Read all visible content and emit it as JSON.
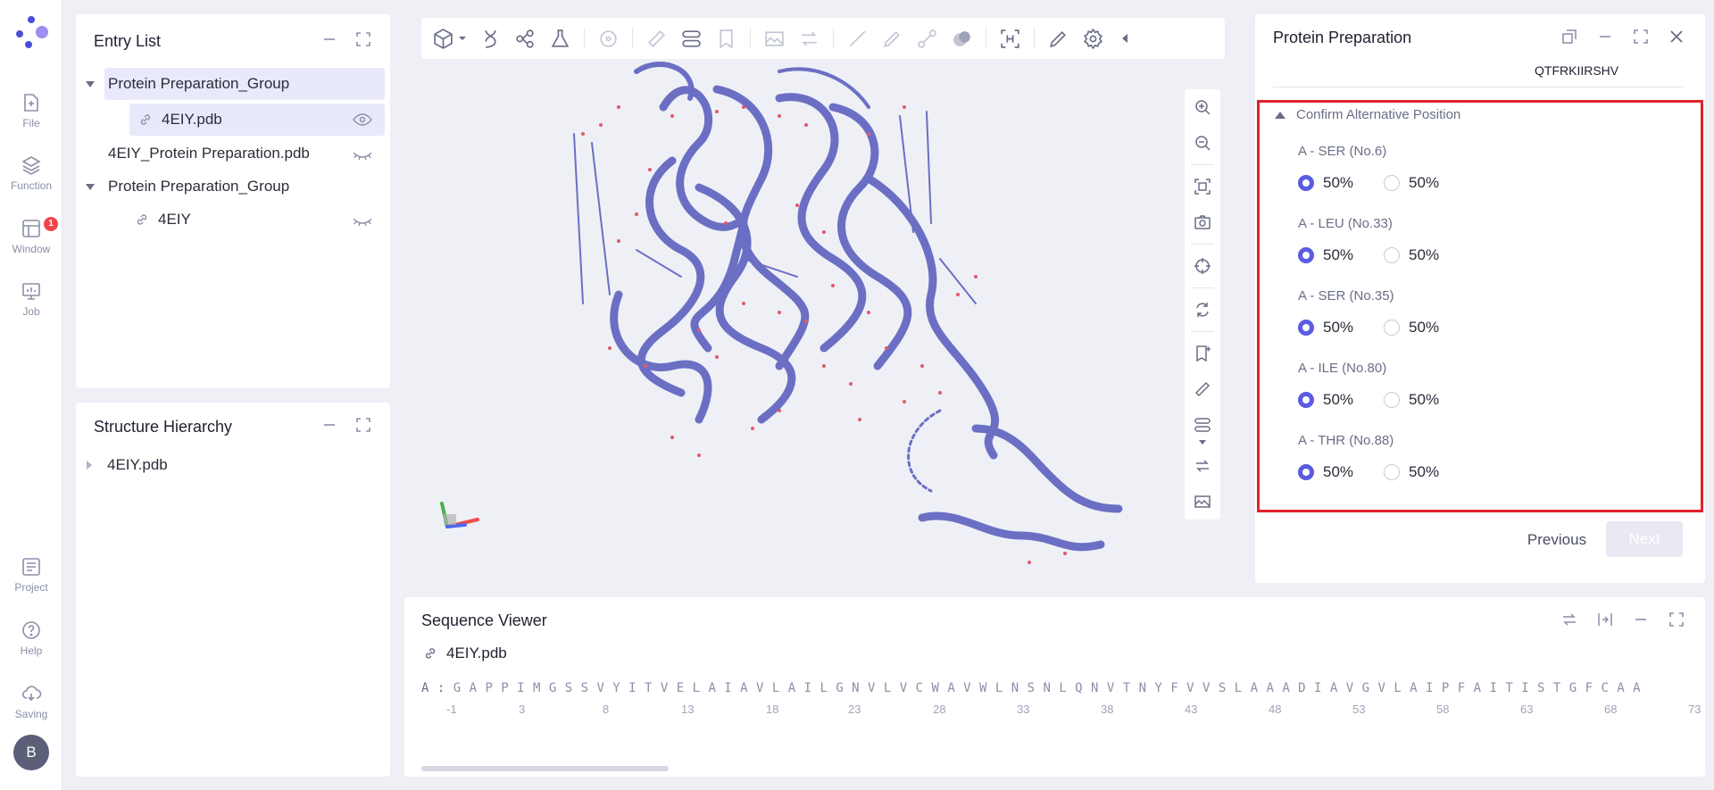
{
  "rail": {
    "file": "File",
    "function": "Function",
    "window": "Window",
    "window_badge": "1",
    "job": "Job",
    "project": "Project",
    "help": "Help",
    "saving": "Saving",
    "avatar": "B"
  },
  "entry_list": {
    "title": "Entry List",
    "items": [
      {
        "label": "Protein Preparation_Group"
      },
      {
        "label": "4EIY.pdb"
      },
      {
        "label": "4EIY_Protein Preparation.pdb"
      },
      {
        "label": "Protein Preparation_Group"
      },
      {
        "label": "4EIY"
      }
    ]
  },
  "structure_hierarchy": {
    "title": "Structure Hierarchy",
    "items": [
      {
        "label": "4EIY.pdb"
      }
    ]
  },
  "protein_preparation": {
    "title": "Protein Preparation",
    "sequence_snippet": "QTFRKIIRSHV",
    "section": "Confirm Alternative Position",
    "residues": [
      {
        "label": "A - SER (No.6)",
        "opt1": "50%",
        "opt2": "50%"
      },
      {
        "label": "A - LEU (No.33)",
        "opt1": "50%",
        "opt2": "50%"
      },
      {
        "label": "A - SER (No.35)",
        "opt1": "50%",
        "opt2": "50%"
      },
      {
        "label": "A - ILE (No.80)",
        "opt1": "50%",
        "opt2": "50%"
      },
      {
        "label": "A - THR (No.88)",
        "opt1": "50%",
        "opt2": "50%"
      }
    ],
    "previous": "Previous",
    "next": "Next"
  },
  "sequence_viewer": {
    "title": "Sequence Viewer",
    "file": "4EIY.pdb",
    "chain": "A :",
    "sequence": "G A P P I M G S S V Y I T V E L A I A V L A I L G N V L V C W A V W L N S N L Q N V T N Y F V V S L A A A D I A V G V L A I P F A I T I S T G F C A A",
    "numbers": [
      "-1",
      "3",
      "8",
      "13",
      "18",
      "23",
      "28",
      "33",
      "38",
      "43",
      "48",
      "53",
      "58",
      "63",
      "68",
      "73"
    ]
  },
  "colors": {
    "accent": "#5a5ce0",
    "protein": "#6b6fc4",
    "highlight": "#e1232a"
  }
}
